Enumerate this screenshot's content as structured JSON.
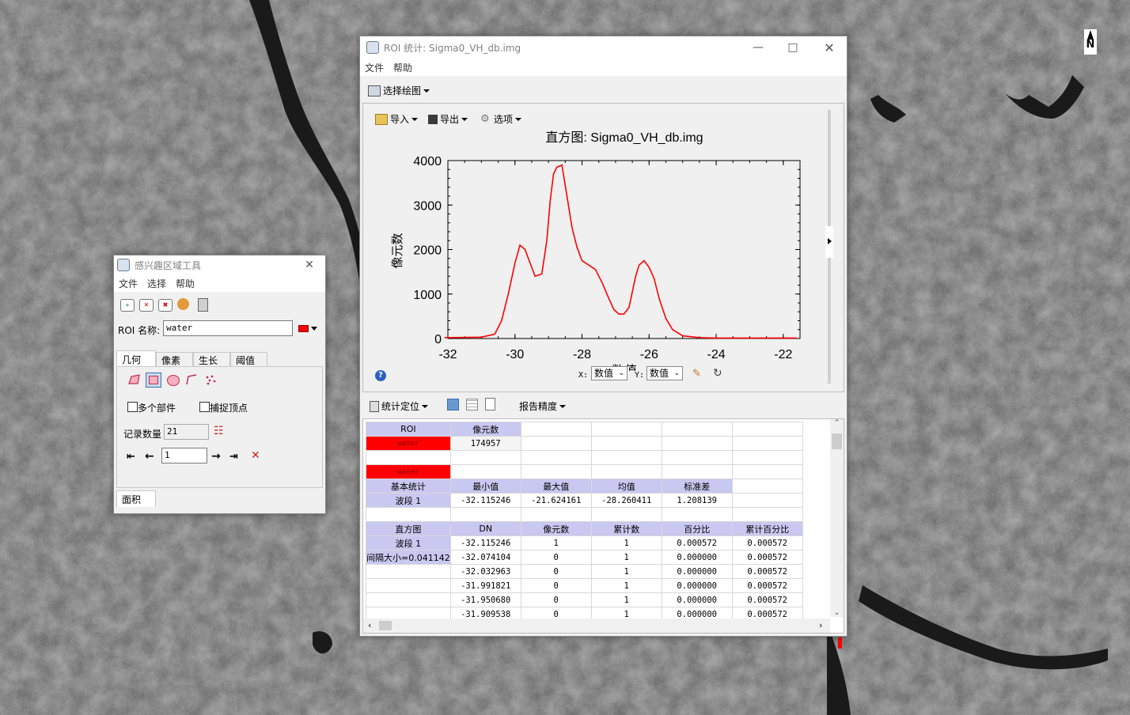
{
  "roi_stats_window": {
    "title": "ROI 统计: Sigma0_VH_db.img",
    "menu": [
      "文件",
      "帮助"
    ],
    "select_plot_label": "选择绘图",
    "plot_toolbar": {
      "import_label": "导入",
      "export_label": "导出",
      "options_label": "选项"
    },
    "x_axis_label": "X:",
    "x_select_value": "数值",
    "y_axis_label": "Y:",
    "y_select_value": "数值",
    "stats_toolbar": {
      "locate_label": "统计定位",
      "precision_label": "报告精度"
    }
  },
  "chart_data": {
    "type": "line",
    "title": "直方图: Sigma0_VH_db.img",
    "xlabel": "数值",
    "ylabel": "像元数",
    "xlim": [
      -32,
      -21.5
    ],
    "ylim": [
      0,
      4000
    ],
    "xticks": [
      "-32",
      "-30",
      "-28",
      "-26",
      "-24",
      "-22"
    ],
    "yticks": [
      "0",
      "1000",
      "2000",
      "3000",
      "4000"
    ],
    "series": [
      {
        "color": "#ff0000",
        "x": [
          -32.1,
          -31.0,
          -30.6,
          -30.4,
          -30.2,
          -30.0,
          -29.85,
          -29.7,
          -29.55,
          -29.4,
          -29.2,
          -29.05,
          -28.95,
          -28.85,
          -28.75,
          -28.6,
          -28.45,
          -28.3,
          -28.15,
          -28.0,
          -27.8,
          -27.6,
          -27.4,
          -27.2,
          -27.05,
          -26.9,
          -26.75,
          -26.6,
          -26.5,
          -26.4,
          -26.3,
          -26.15,
          -26.0,
          -25.85,
          -25.7,
          -25.5,
          -25.3,
          -25.0,
          -24.5,
          -24.0,
          -23.0,
          -22.0,
          -21.6
        ],
        "y": [
          20,
          30,
          100,
          400,
          1000,
          1700,
          2100,
          2000,
          1700,
          1400,
          1450,
          2200,
          3100,
          3700,
          3850,
          3900,
          3200,
          2500,
          2050,
          1750,
          1650,
          1550,
          1250,
          900,
          650,
          550,
          550,
          700,
          1050,
          1400,
          1650,
          1750,
          1600,
          1350,
          900,
          450,
          200,
          60,
          20,
          10,
          10,
          10,
          10
        ]
      }
    ]
  },
  "stats_table": {
    "rows": [
      [
        "ROI",
        "像元数",
        "",
        "",
        "",
        ""
      ],
      [
        "water",
        "174957",
        "",
        "",
        "",
        ""
      ],
      [
        "",
        "",
        "",
        "",
        "",
        ""
      ],
      [
        "water",
        "",
        "",
        "",
        "",
        ""
      ],
      [
        "基本统计",
        "最小值",
        "最大值",
        "均值",
        "标准差",
        ""
      ],
      [
        "波段 1",
        "-32.115246",
        "-21.624161",
        "-28.260411",
        "1.208139",
        ""
      ],
      [
        "",
        "",
        "",
        "",
        "",
        ""
      ],
      [
        "直方图",
        "DN",
        "像元数",
        "累计数",
        "百分比",
        "累计百分比"
      ],
      [
        "波段 1",
        "-32.115246",
        "1",
        "1",
        "0.000572",
        "0.000572"
      ],
      [
        "间隔大小=0.041142",
        "-32.074104",
        "0",
        "1",
        "0.000000",
        "0.000572"
      ],
      [
        "",
        "-32.032963",
        "0",
        "1",
        "0.000000",
        "0.000572"
      ],
      [
        "",
        "-31.991821",
        "0",
        "1",
        "0.000000",
        "0.000572"
      ],
      [
        "",
        "-31.950680",
        "0",
        "1",
        "0.000000",
        "0.000572"
      ],
      [
        "",
        "-31.909538",
        "0",
        "1",
        "0.000000",
        "0.000572"
      ]
    ]
  },
  "roi_tool_window": {
    "title": "感兴趣区域工具",
    "menu": [
      "文件",
      "选择",
      "帮助"
    ],
    "roi_label": "ROI 名称:",
    "roi_name": "water",
    "roi_color": "#ff0000",
    "tabs": [
      "几何",
      "像素",
      "生长",
      "阈值"
    ],
    "multi_part_label": "多个部件",
    "snap_vertex_label": "捕捉顶点",
    "record_count_label": "记录数量",
    "record_count": "21",
    "record_index": "1",
    "bottom_tab": "面积"
  },
  "north_arrow_label": "N"
}
